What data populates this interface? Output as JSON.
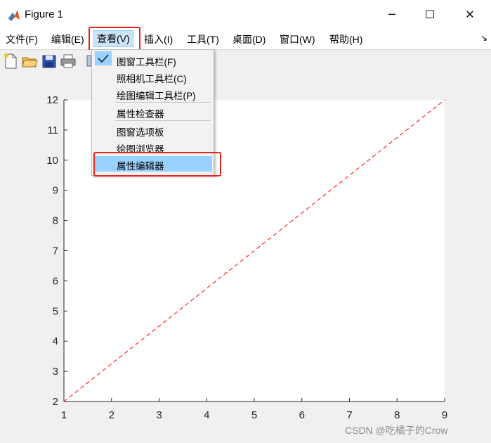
{
  "window": {
    "title": "Figure 1",
    "icon": "matlab-logo-icon",
    "controls": {
      "minimize": "─",
      "maximize": "☐",
      "close": "✕"
    }
  },
  "menubar": {
    "items": [
      {
        "label": "文件(F)"
      },
      {
        "label": "编辑(E)"
      },
      {
        "label": "查看(V)",
        "active": true
      },
      {
        "label": "插入(I)"
      },
      {
        "label": "工具(T)"
      },
      {
        "label": "桌面(D)"
      },
      {
        "label": "窗口(W)"
      },
      {
        "label": "帮助(H)"
      }
    ],
    "overflow_glyph": "↘"
  },
  "toolbar": {
    "buttons": [
      "new-figure-icon",
      "open-folder-icon",
      "save-icon",
      "print-icon"
    ]
  },
  "view_menu": {
    "items": [
      {
        "label": "图窗工具栏(F)",
        "checked": true
      },
      {
        "label": "照相机工具栏(C)"
      },
      {
        "label": "绘图编辑工具栏(P)"
      },
      {
        "label": "属性检查器"
      },
      {
        "label": "图窗选项板"
      },
      {
        "label": "绘图浏览器"
      },
      {
        "label": "属性编辑器",
        "highlighted": true
      }
    ],
    "check_glyph": "✓"
  },
  "chart_data": {
    "type": "line",
    "series": [
      {
        "x": [
          1,
          9
        ],
        "y": [
          2,
          12
        ],
        "style": "dashed",
        "color": "#ff0000"
      }
    ],
    "xlim": [
      1,
      9
    ],
    "ylim": [
      2,
      12
    ],
    "xticks": [
      1,
      2,
      3,
      4,
      5,
      6,
      7,
      8,
      9
    ],
    "yticks": [
      2,
      3,
      4,
      5,
      6,
      7,
      8,
      9,
      10,
      11,
      12
    ],
    "grid": false,
    "title": "",
    "xlabel": "",
    "ylabel": ""
  },
  "highlight_color": "#e8241e",
  "watermark": "CSDN @吃橘子的Crow"
}
